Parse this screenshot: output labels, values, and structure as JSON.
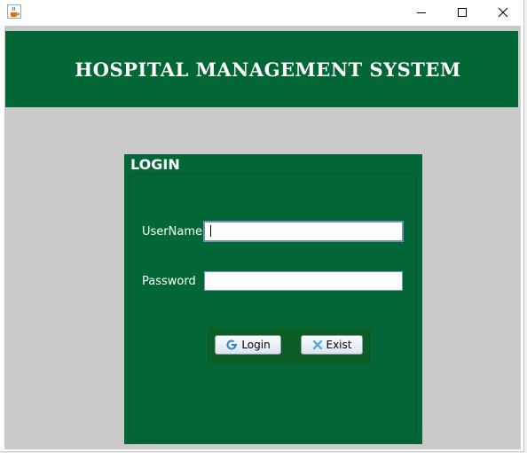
{
  "window": {
    "icon": "java-cup-icon",
    "controls": {
      "minimize": "minimize-icon",
      "maximize": "maximize-icon",
      "close": "close-icon"
    }
  },
  "header": {
    "title": "HOSPITAL MANAGEMENT SYSTEM"
  },
  "login": {
    "title": "LOGIN",
    "username_label": "UserName",
    "username_value": "",
    "password_label": "Password",
    "password_value": "",
    "login_button": "Login",
    "login_icon": "refresh-arrow-icon",
    "exit_button": "Exist",
    "exit_icon": "x-icon"
  },
  "colors": {
    "panel_green": "#036636",
    "button_bar_green": "#0b5e25",
    "background_gray": "#cacaca",
    "login_icon_blue": "#2f7fd6",
    "exit_icon_blue": "#5aa8e0"
  }
}
